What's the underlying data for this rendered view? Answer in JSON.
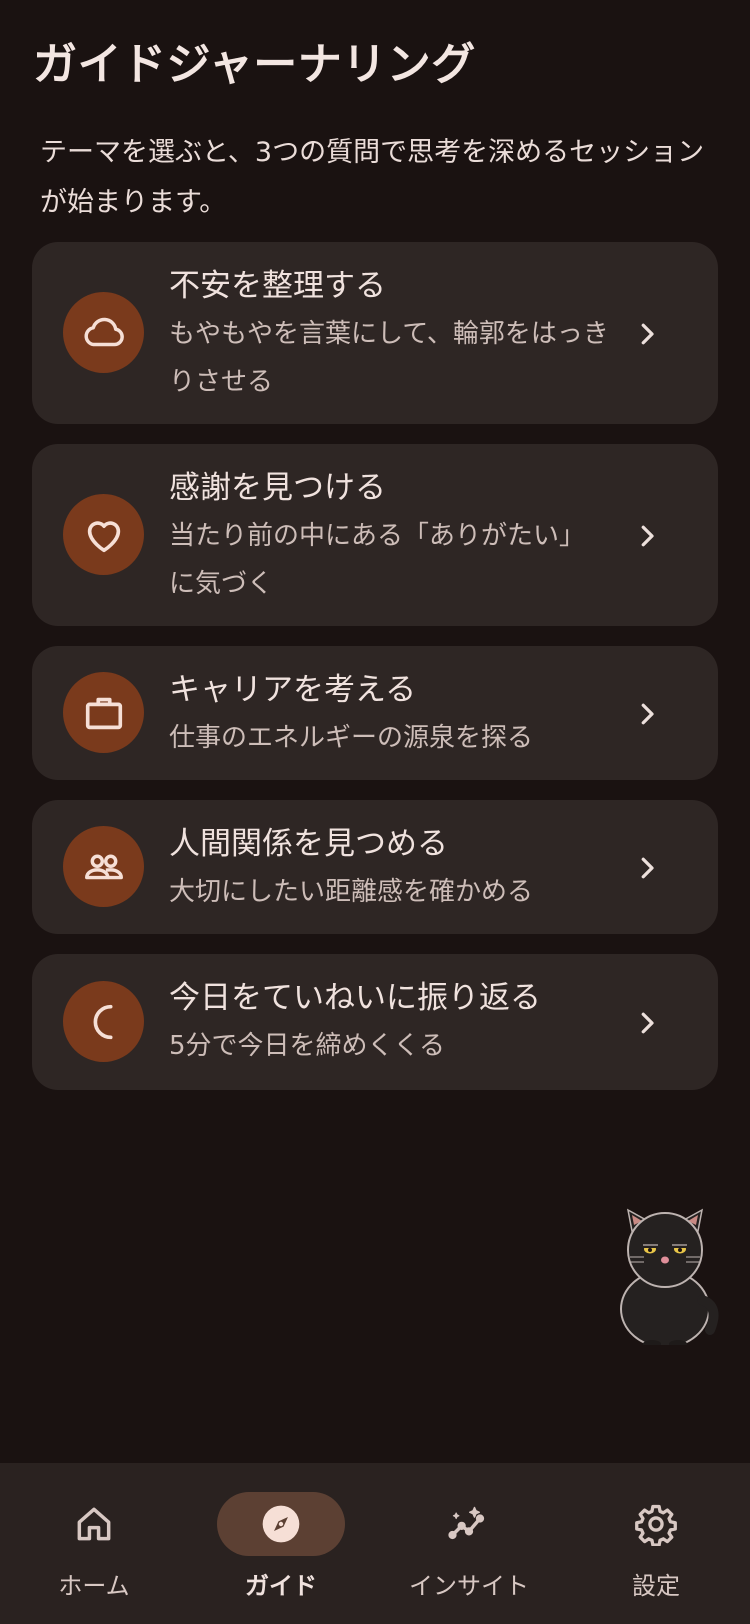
{
  "header": {
    "title": "ガイドジャーナリング"
  },
  "intro": "テーマを選ぶと、3つの質問で思考を深めるセッションが始まります。",
  "themes": [
    {
      "title": "不安を整理する",
      "subtitle": "もやもやを言葉にして、輪郭をはっきりさせる",
      "icon": "cloud-icon"
    },
    {
      "title": "感謝を見つける",
      "subtitle": "当たり前の中にある「ありがたい」に気づく",
      "icon": "heart-icon"
    },
    {
      "title": "キャリアを考える",
      "subtitle": "仕事のエネルギーの源泉を探る",
      "icon": "briefcase-icon"
    },
    {
      "title": "人間関係を見つめる",
      "subtitle": "大切にしたい距離感を確かめる",
      "icon": "people-icon"
    },
    {
      "title": "今日をていねいに振り返る",
      "subtitle": "5分で今日を締めくくる",
      "icon": "moon-icon"
    }
  ],
  "nav": {
    "items": [
      {
        "label": "ホーム",
        "icon": "home-icon",
        "active": false
      },
      {
        "label": "ガイド",
        "icon": "compass-icon",
        "active": true
      },
      {
        "label": "インサイト",
        "icon": "insights-icon",
        "active": false
      },
      {
        "label": "設定",
        "icon": "gear-icon",
        "active": false
      }
    ]
  },
  "colors": {
    "background": "#1a1211",
    "card": "#2e2624",
    "accent": "#7a3a1c",
    "nav_active": "#5c4033"
  }
}
